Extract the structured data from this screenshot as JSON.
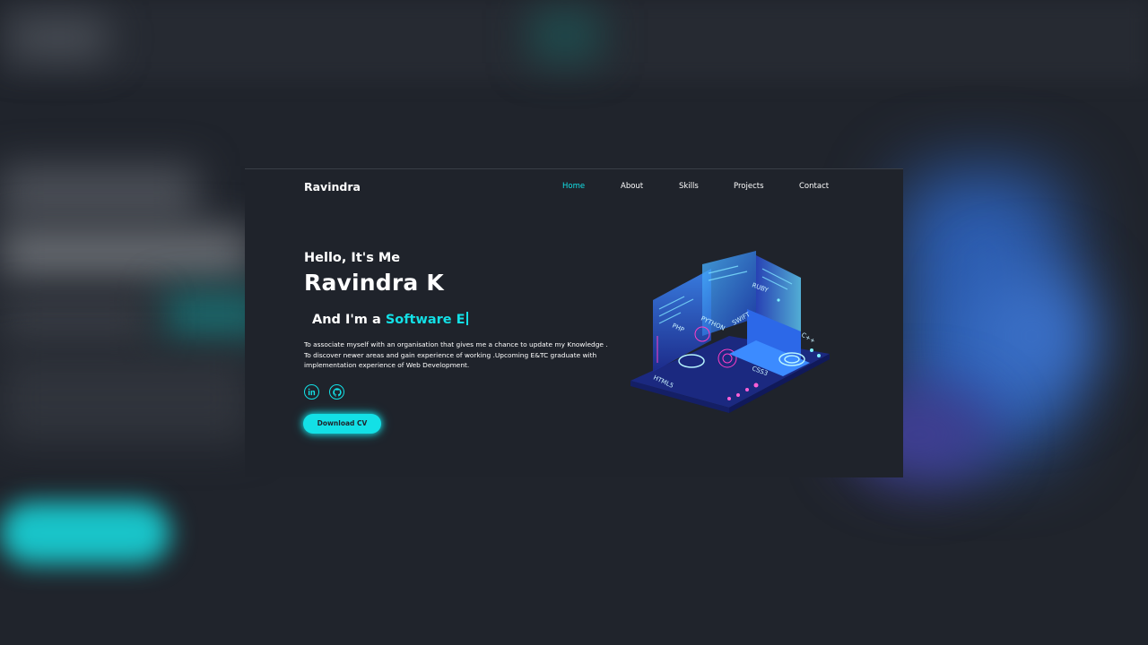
{
  "brand": "Ravindra",
  "nav": {
    "items": [
      {
        "label": "Home",
        "active": true
      },
      {
        "label": "About",
        "active": false
      },
      {
        "label": "Skills",
        "active": false
      },
      {
        "label": "Projects",
        "active": false
      },
      {
        "label": "Contact",
        "active": false
      }
    ]
  },
  "hero": {
    "greeting": "Hello, It's Me",
    "name": "Ravindra K",
    "role_prefix": "And I'm a",
    "role_typed": "Software E",
    "bio": "To associate myself with an organisation that gives me a chance to update my Knowledge . To discover newer areas and gain experience of working .Upcoming E&TC graduate with implementation experience of Web Development.",
    "download_label": "Download CV",
    "art_labels": [
      "RUBY",
      "PYTHON",
      "PHP",
      "SWIFT",
      "HTML5",
      "CSS3",
      "C++"
    ]
  },
  "social": [
    {
      "icon": "linkedin-icon"
    },
    {
      "icon": "github-icon"
    }
  ],
  "colors": {
    "accent": "#13e0e6",
    "background": "#1f232b",
    "text": "#ffffff"
  }
}
